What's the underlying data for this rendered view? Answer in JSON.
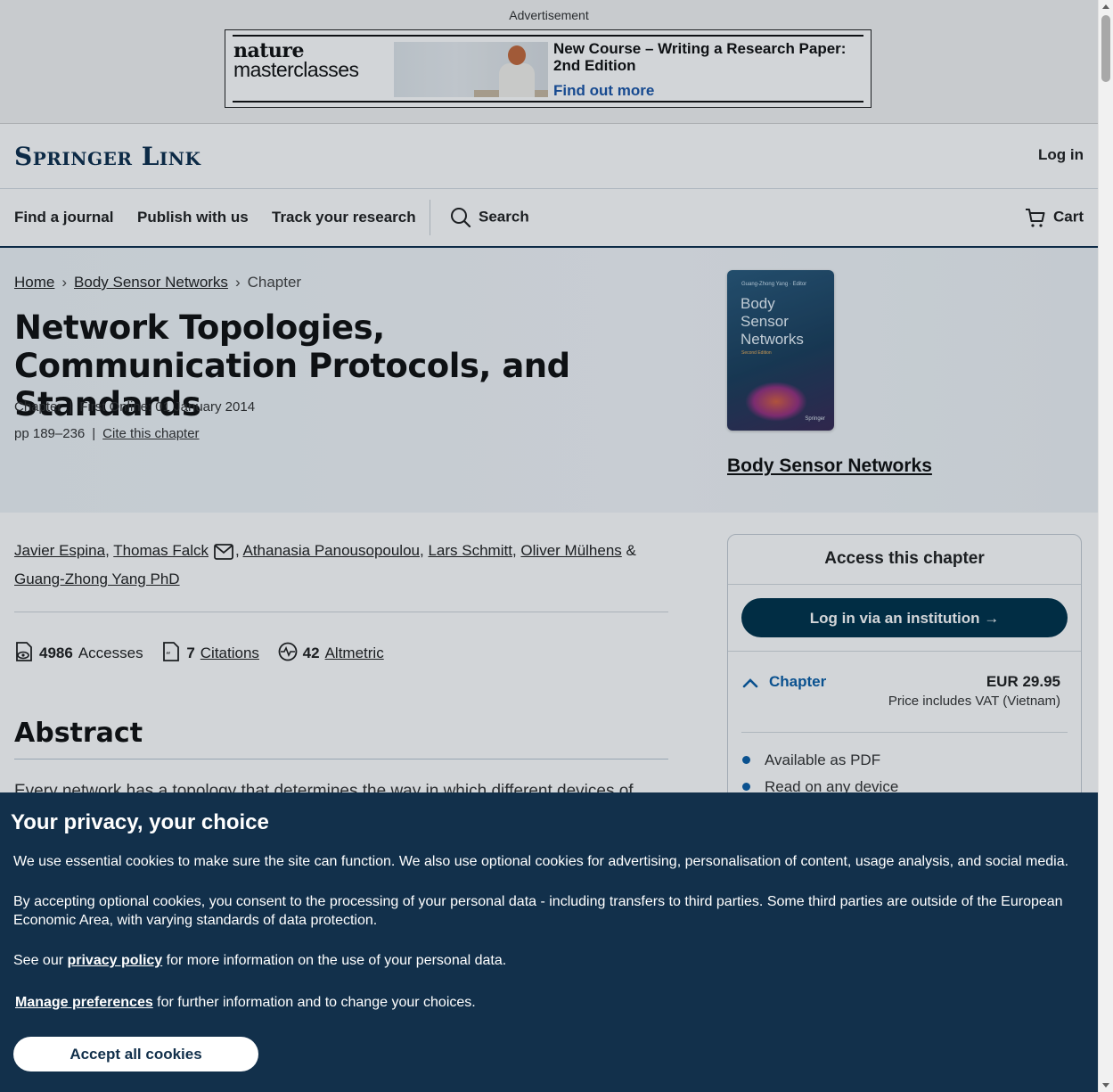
{
  "ad": {
    "label": "Advertisement",
    "brand_line1": "nature",
    "brand_line2": "masterclasses",
    "title": "New Course – Writing a Research Paper: 2nd Edition",
    "cta": "Find out more"
  },
  "header": {
    "logo": "Springer Link",
    "login": "Log in"
  },
  "nav": {
    "items": [
      "Find a journal",
      "Publish with us",
      "Track your research"
    ],
    "search": "Search",
    "cart": "Cart"
  },
  "breadcrumb": {
    "home": "Home",
    "book": "Body Sensor Networks",
    "current": "Chapter"
  },
  "chapter": {
    "title": "Network Topologies, Communication Protocols, and Standards",
    "type": "Chapter",
    "first_online": "First Online: 01 January 2014",
    "pages": "pp 189–236",
    "cite": "Cite this chapter"
  },
  "book": {
    "title_link": "Body Sensor Networks",
    "cover_editor": "Guang-Zhong Yang · Editor",
    "cover_title_1": "Body",
    "cover_title_2": "Sensor",
    "cover_title_3": "Networks",
    "cover_edition": "Second Edition",
    "cover_publisher": "Springer"
  },
  "authors": {
    "a1": "Javier Espina",
    "a2": "Thomas Falck",
    "a3": "Athanasia Panousopoulou",
    "a4": "Lars Schmitt",
    "a5": "Oliver Mülhens",
    "a6": "Guang-Zhong Yang PhD",
    "comma": ",",
    "amp": "&"
  },
  "metrics": {
    "accesses_count": "4986",
    "accesses_label": "Accesses",
    "citations_count": "7",
    "citations_label": "Citations",
    "altmetric_count": "42",
    "altmetric_label": "Altmetric"
  },
  "abstract": {
    "heading": "Abstract",
    "text": "Every network has a topology that determines the way in which different devices of"
  },
  "access": {
    "title": "Access this chapter",
    "login_button": "Log in via an institution",
    "option_label": "Chapter",
    "price": "EUR 29.95",
    "vat": "Price includes VAT (Vietnam)",
    "features": [
      "Available as PDF",
      "Read on any device"
    ]
  },
  "cookie": {
    "title": "Your privacy, your choice",
    "p1": "We use essential cookies to make sure the site can function. We also use optional cookies for advertising, personalisation of content, usage analysis, and social media.",
    "p2": "By accepting optional cookies, you consent to the processing of your personal data - including transfers to third parties. Some third parties are outside of the European Economic Area, with varying standards of data protection.",
    "p3_pre": "See our ",
    "p3_link": "privacy policy",
    "p3_post": " for more information on the use of your personal data.",
    "p4_link": "Manage preferences",
    "p4_post": " for further information and to change your choices.",
    "accept": "Accept all cookies"
  },
  "colors": {
    "brand_navy": "#0e2f4d",
    "button_navy": "#01324b",
    "link_blue": "#0b5fa6",
    "cookie_bg": "#12304b"
  }
}
